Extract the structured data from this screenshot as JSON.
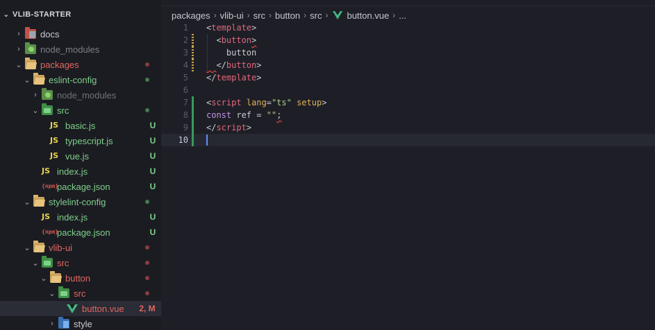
{
  "sidebar": {
    "title": "VLIB-STARTER",
    "items": [
      {
        "label": "docs",
        "icon": "folder-docs-icon",
        "arrow": "›",
        "depth": 0,
        "color": "#c9cbd3",
        "status": "",
        "dot": ""
      },
      {
        "label": "node_modules",
        "icon": "folder-node-icon",
        "arrow": "›",
        "depth": 0,
        "color": "#7c7f89",
        "status": "",
        "dot": ""
      },
      {
        "label": "packages",
        "icon": "folder-open-icon",
        "arrow": "⌄",
        "depth": 0,
        "color": "#e2675f",
        "status": "",
        "dot": "#8a3d3d"
      },
      {
        "label": "eslint-config",
        "icon": "folder-open-icon",
        "arrow": "⌄",
        "depth": 1,
        "color": "#7fcf8a",
        "status": "",
        "dot": "#3f7d4d"
      },
      {
        "label": "node_modules",
        "icon": "folder-node-icon",
        "arrow": "›",
        "depth": 2,
        "color": "#6f727c",
        "status": "",
        "dot": ""
      },
      {
        "label": "src",
        "icon": "folder-src-icon",
        "arrow": "⌄",
        "depth": 2,
        "color": "#7fcf8a",
        "status": "",
        "dot": "#3f7d4d"
      },
      {
        "label": "basic.js",
        "icon": "js-icon",
        "arrow": "",
        "depth": 3,
        "color": "#7fcf8a",
        "status": "U",
        "dot": ""
      },
      {
        "label": "typescript.js",
        "icon": "js-icon",
        "arrow": "",
        "depth": 3,
        "color": "#7fcf8a",
        "status": "U",
        "dot": ""
      },
      {
        "label": "vue.js",
        "icon": "js-icon",
        "arrow": "",
        "depth": 3,
        "color": "#7fcf8a",
        "status": "U",
        "dot": ""
      },
      {
        "label": "index.js",
        "icon": "js-icon",
        "arrow": "",
        "depth": 2,
        "color": "#7fcf8a",
        "status": "U",
        "dot": ""
      },
      {
        "label": "package.json",
        "icon": "package-json-icon",
        "arrow": "",
        "depth": 2,
        "color": "#7fcf8a",
        "status": "U",
        "dot": ""
      },
      {
        "label": "stylelint-config",
        "icon": "folder-open-icon",
        "arrow": "⌄",
        "depth": 1,
        "color": "#7fcf8a",
        "status": "",
        "dot": "#3f7d4d"
      },
      {
        "label": "index.js",
        "icon": "js-icon",
        "arrow": "",
        "depth": 2,
        "color": "#7fcf8a",
        "status": "U",
        "dot": ""
      },
      {
        "label": "package.json",
        "icon": "package-json-icon",
        "arrow": "",
        "depth": 2,
        "color": "#7fcf8a",
        "status": "U",
        "dot": ""
      },
      {
        "label": "vlib-ui",
        "icon": "folder-open-icon",
        "arrow": "⌄",
        "depth": 1,
        "color": "#e2675f",
        "status": "",
        "dot": "#8a3d3d"
      },
      {
        "label": "src",
        "icon": "folder-src-icon",
        "arrow": "⌄",
        "depth": 2,
        "color": "#e2675f",
        "status": "",
        "dot": "#8a3d3d"
      },
      {
        "label": "button",
        "icon": "folder-open-icon",
        "arrow": "⌄",
        "depth": 3,
        "color": "#e2675f",
        "status": "",
        "dot": "#8a3d3d"
      },
      {
        "label": "src",
        "icon": "folder-src-icon",
        "arrow": "⌄",
        "depth": 4,
        "color": "#e2675f",
        "status": "",
        "dot": "#8a3d3d"
      },
      {
        "label": "button.vue",
        "icon": "vue-icon",
        "arrow": "",
        "depth": 5,
        "color": "#e2675f",
        "status": "2, M",
        "dot": "",
        "selected": true
      },
      {
        "label": "style",
        "icon": "folder-style-icon",
        "arrow": "›",
        "depth": 4,
        "color": "#c9cbd3",
        "status": "",
        "dot": ""
      }
    ]
  },
  "breadcrumb": [
    "packages",
    "vlib-ui",
    "src",
    "button",
    "src",
    "button.vue",
    "..."
  ],
  "editor": {
    "line_numbers": [
      "1",
      "2",
      "3",
      "4",
      "5",
      "6",
      "7",
      "8",
      "9",
      "10"
    ],
    "current_line": "10",
    "lines": [
      [
        {
          "t": "<",
          "c": "punc"
        },
        {
          "t": "template",
          "c": "tag"
        },
        {
          "t": ">",
          "c": "punc"
        }
      ],
      [
        {
          "t": "  <",
          "c": "punc"
        },
        {
          "t": "button",
          "c": "tag"
        },
        {
          "t": ">",
          "c": "punc",
          "sq": true
        }
      ],
      [
        {
          "t": "    button",
          "c": "txt"
        }
      ],
      [
        {
          "t": "  ",
          "c": "punc",
          "sq": true
        },
        {
          "t": "</",
          "c": "punc"
        },
        {
          "t": "button",
          "c": "tag"
        },
        {
          "t": ">",
          "c": "punc"
        }
      ],
      [
        {
          "t": "</",
          "c": "punc"
        },
        {
          "t": "template",
          "c": "tag"
        },
        {
          "t": ">",
          "c": "punc"
        }
      ],
      [],
      [
        {
          "t": "<",
          "c": "punc"
        },
        {
          "t": "script",
          "c": "tag"
        },
        {
          "t": " lang",
          "c": "attr"
        },
        {
          "t": "=",
          "c": "punc"
        },
        {
          "t": "\"ts\"",
          "c": "str"
        },
        {
          "t": " setup",
          "c": "attr"
        },
        {
          "t": ">",
          "c": "punc"
        }
      ],
      [
        {
          "t": "const",
          "c": "kw"
        },
        {
          "t": " ref = ",
          "c": "txt"
        },
        {
          "t": "\"\"",
          "c": "str"
        },
        {
          "t": ";",
          "c": "punc",
          "sq": true
        }
      ],
      [
        {
          "t": "</",
          "c": "punc"
        },
        {
          "t": "script",
          "c": "tag"
        },
        {
          "t": ">",
          "c": "punc"
        }
      ],
      []
    ],
    "gutter": [
      "none",
      "modified",
      "modified",
      "modified",
      "none",
      "none",
      "added",
      "added",
      "added",
      "added"
    ]
  },
  "colors": {
    "sidebar_bg": "#1b1c22",
    "editor_bg": "#1e1f26",
    "selection_bg": "#2a2c36",
    "untracked": "#7fcf8a",
    "modified": "#e2675f"
  }
}
